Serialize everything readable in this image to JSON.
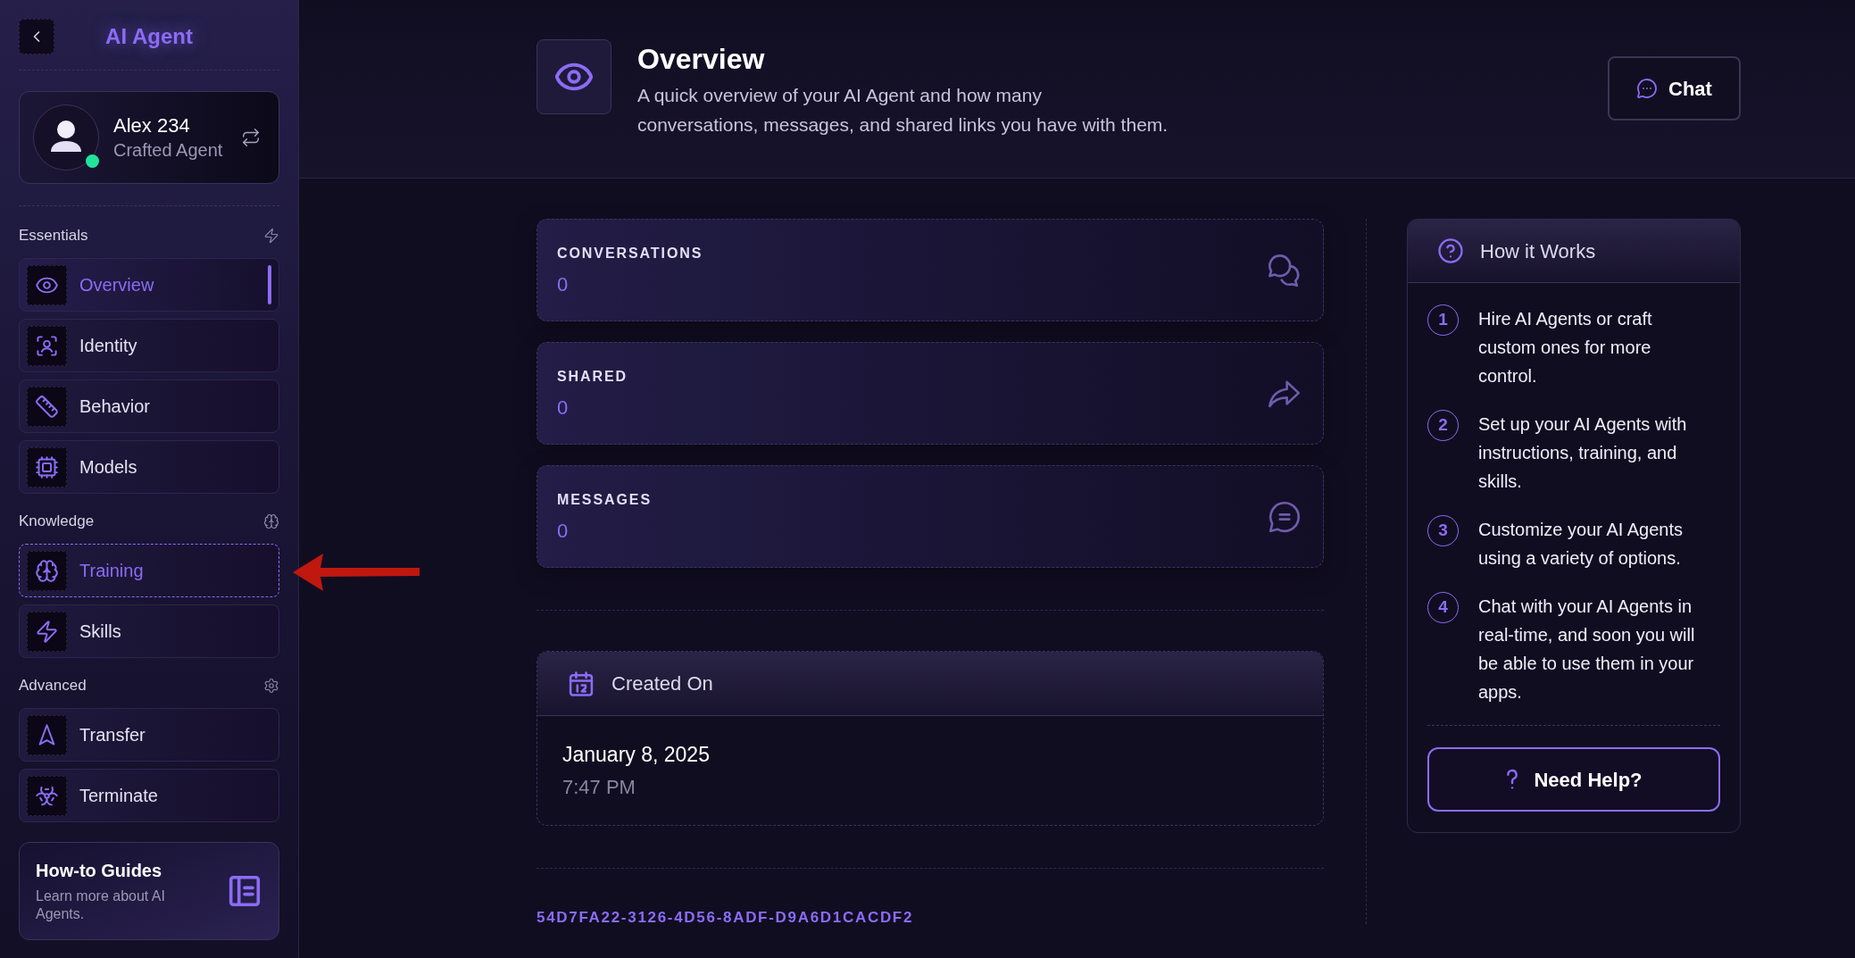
{
  "sidebar": {
    "title": "AI Agent",
    "profile": {
      "name": "Alex 234",
      "role": "Crafted Agent",
      "online": true
    },
    "sections": [
      {
        "title": "Essentials",
        "items": [
          {
            "label": "Overview",
            "selected": true,
            "focused": false
          },
          {
            "label": "Identity",
            "selected": false,
            "focused": false
          },
          {
            "label": "Behavior",
            "selected": false,
            "focused": false
          },
          {
            "label": "Models",
            "selected": false,
            "focused": false
          }
        ]
      },
      {
        "title": "Knowledge",
        "items": [
          {
            "label": "Training",
            "selected": false,
            "focused": true
          },
          {
            "label": "Skills",
            "selected": false,
            "focused": false
          }
        ]
      },
      {
        "title": "Advanced",
        "items": [
          {
            "label": "Transfer",
            "selected": false,
            "focused": false
          },
          {
            "label": "Terminate",
            "selected": false,
            "focused": false
          }
        ]
      }
    ],
    "guide_card": {
      "title": "How-to Guides",
      "text": "Learn more about AI Agents."
    }
  },
  "header": {
    "title": "Overview",
    "description": "A quick overview of your AI Agent and how many\nconversations, messages, and shared links you have with them.",
    "chat_button": "Chat"
  },
  "stats": [
    {
      "label": "CONVERSATIONS",
      "value": "0"
    },
    {
      "label": "SHARED",
      "value": "0"
    },
    {
      "label": "MESSAGES",
      "value": "0"
    }
  ],
  "created": {
    "title": "Created On",
    "date": "January 8, 2025",
    "time": "7:47 PM"
  },
  "agent_id": "54D7FA22-3126-4D56-8ADF-D9A6D1CACDF2",
  "how_it_works": {
    "title": "How it Works",
    "steps": [
      {
        "number": "1",
        "text": "Hire AI Agents or craft custom ones for more control."
      },
      {
        "number": "2",
        "text": "Set up your AI Agents with instructions, training, and skills."
      },
      {
        "number": "3",
        "text": "Customize your AI Agents using a variety of options."
      },
      {
        "number": "4",
        "text": "Chat with your AI Agents in real-time, and soon you will be able to use them in your apps."
      }
    ],
    "help_button": "Need Help?"
  }
}
